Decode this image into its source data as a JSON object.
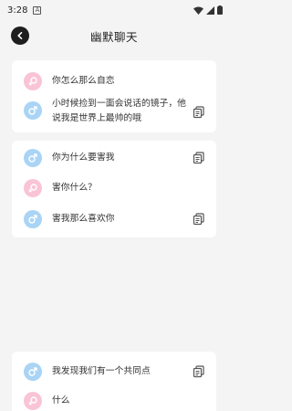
{
  "status": {
    "time": "3:28",
    "app_badge": "A"
  },
  "header": {
    "title": "幽默聊天"
  },
  "conversations": [
    {
      "messages": [
        {
          "gender": "female",
          "text": "你怎么那么自恋",
          "copy": false
        },
        {
          "gender": "male",
          "text": "小时候捡到一面会说话的镜子，他说我是世界上最帅的哦",
          "copy": true
        }
      ]
    },
    {
      "messages": [
        {
          "gender": "male",
          "text": "你为什么要害我",
          "copy": true
        },
        {
          "gender": "female",
          "text": "害你什么？",
          "copy": false
        },
        {
          "gender": "male",
          "text": "害我那么喜欢你",
          "copy": true
        }
      ]
    },
    {
      "messages": [
        {
          "gender": "male",
          "text": "我发现我们有一个共同点",
          "copy": true
        },
        {
          "gender": "female",
          "text": "什么",
          "copy": false
        }
      ]
    }
  ]
}
